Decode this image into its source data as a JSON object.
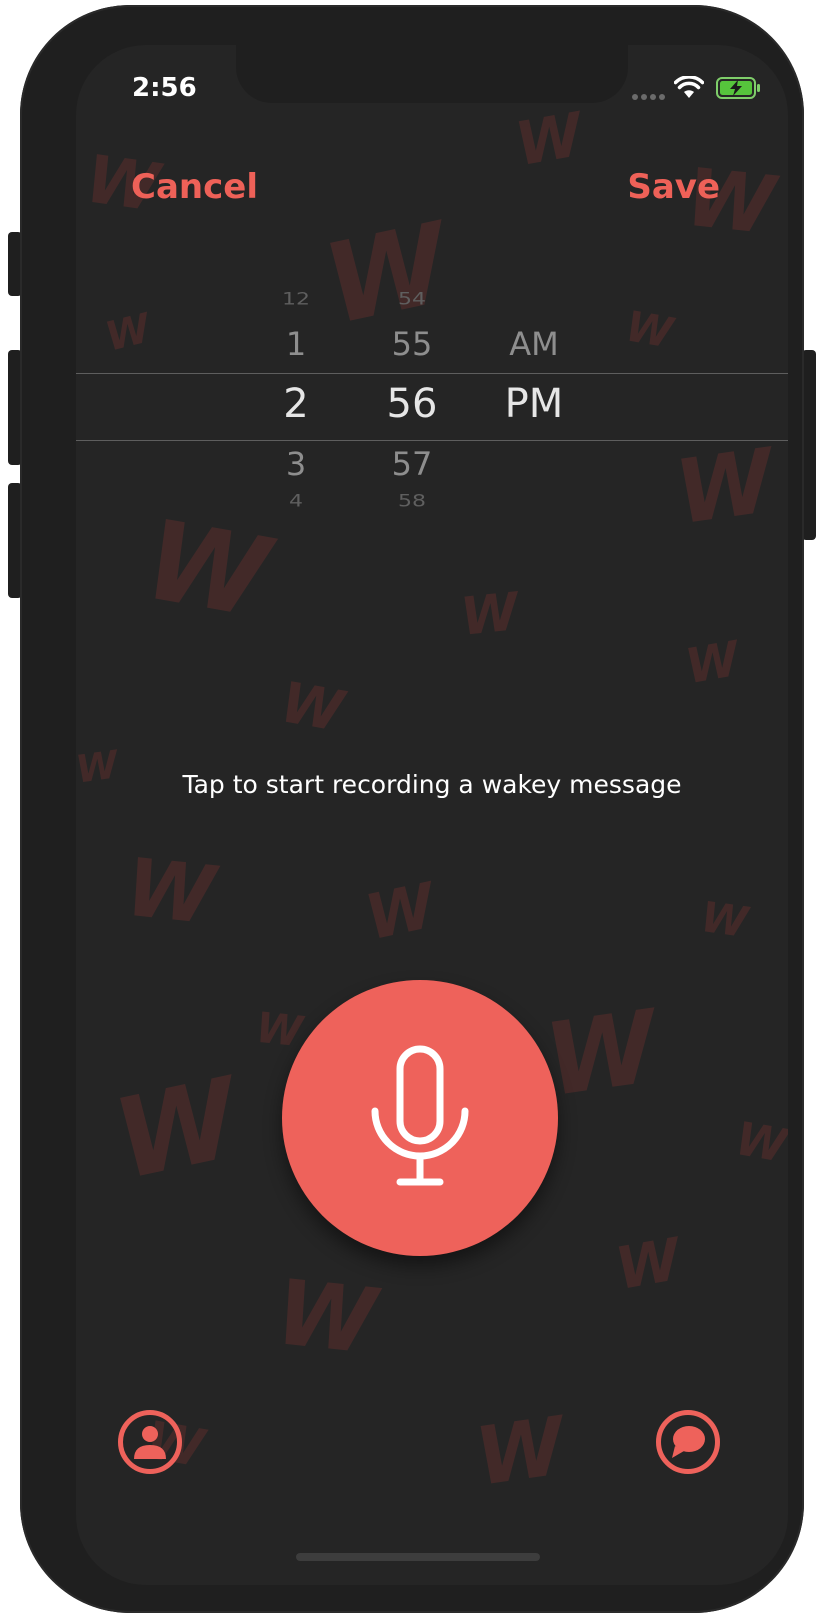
{
  "status_bar": {
    "time": "2:56"
  },
  "nav": {
    "cancel_label": "Cancel",
    "save_label": "Save"
  },
  "picker": {
    "hours": [
      "12",
      "1",
      "2",
      "3",
      "4"
    ],
    "minutes": [
      "54",
      "55",
      "56",
      "57",
      "58"
    ],
    "periods": [
      "AM",
      "PM"
    ],
    "selected": {
      "hour": "2",
      "minute": "56",
      "period": "PM"
    }
  },
  "prompt_text": "Tap to start recording a wakey message",
  "icons": {
    "record": "microphone-icon",
    "profile": "profile-icon",
    "messages": "chat-bubble-icon"
  },
  "colors": {
    "accent": "#ee625b",
    "background": "#252525"
  }
}
